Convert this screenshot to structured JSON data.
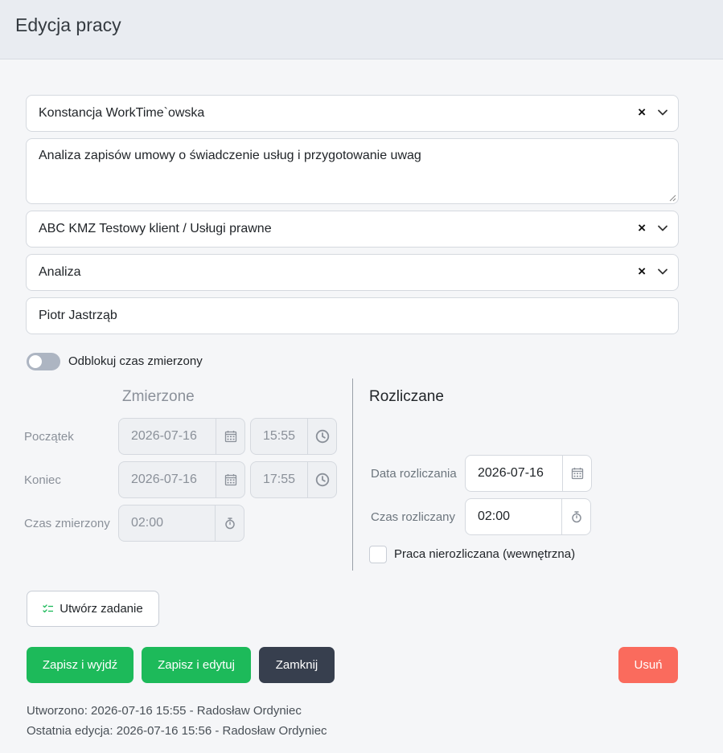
{
  "header": {
    "title": "Edycja pracy"
  },
  "form": {
    "employee": "Konstancja WorkTime`owska",
    "description": "Analiza zapisów umowy o świadczenie usług i przygotowanie uwag",
    "client": "ABC KMZ Testowy klient / Usługi prawne",
    "activity": "Analiza",
    "person": "Piotr Jastrząb",
    "clear_glyph": "×"
  },
  "toggle": {
    "label": "Odblokuj czas zmierzony",
    "on": false
  },
  "measured": {
    "title": "Zmierzone",
    "start_label": "Początek",
    "start_date": "2026-07-16",
    "start_time": "15:55",
    "end_label": "Koniec",
    "end_date": "2026-07-16",
    "end_time": "17:55",
    "duration_label": "Czas zmierzony",
    "duration": "02:00"
  },
  "billed": {
    "title": "Rozliczane",
    "date_label": "Data rozliczania",
    "date": "2026-07-16",
    "duration_label": "Czas rozliczany",
    "duration": "02:00",
    "internal_label": "Praca nierozliczana (wewnętrzna)",
    "internal_checked": false
  },
  "buttons": {
    "create_task": "Utwórz zadanie",
    "save_exit": "Zapisz i wyjdź",
    "save_edit": "Zapisz i edytuj",
    "close": "Zamknij",
    "delete": "Usuń"
  },
  "meta": {
    "created": "Utworzono: 2026-07-16 15:55 - Radosław Ordyniec",
    "edited": "Ostatnia edycja: 2026-07-16 15:56 - Radosław Ordyniec"
  },
  "colors": {
    "green": "#1dba5a",
    "dark": "#373f4e",
    "red": "#fa6b5d",
    "header_bg": "#e9ecf1"
  },
  "icons": [
    "chevron-down-icon",
    "calendar-icon",
    "clock-icon",
    "stopwatch-icon",
    "checklist-icon"
  ]
}
